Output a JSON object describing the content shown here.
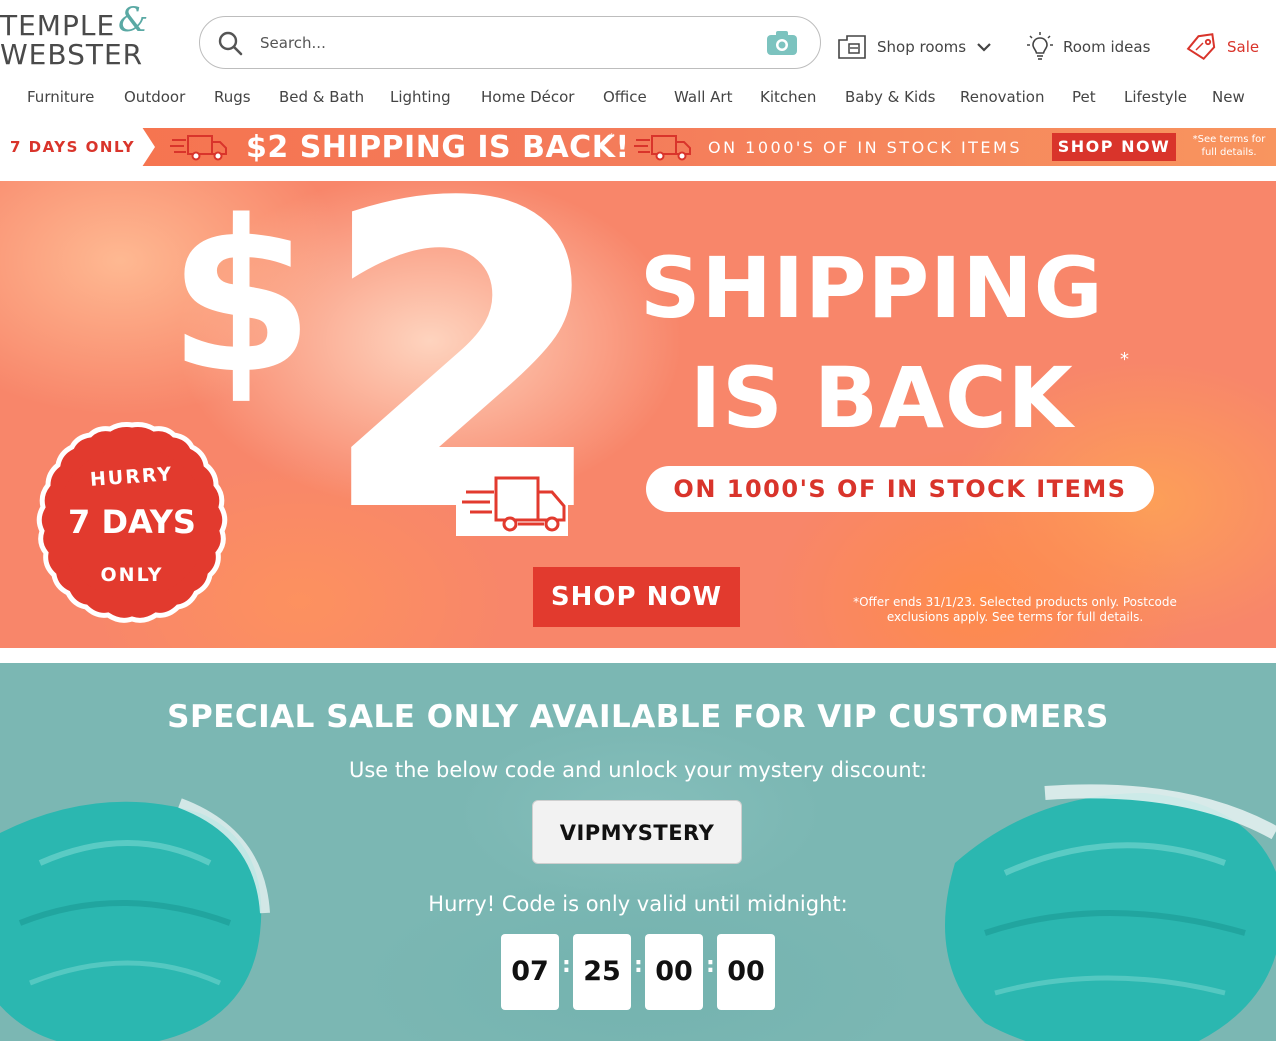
{
  "brand": {
    "line1": "TEMPLE",
    "line2": "WEBSTER",
    "ampersand": "&",
    "accent": "#5aa9a4"
  },
  "search": {
    "placeholder": "Search...",
    "value": ""
  },
  "header_links": {
    "shop_rooms": "Shop rooms",
    "room_ideas": "Room ideas",
    "sale": "Sale"
  },
  "nav": [
    "Furniture",
    "Outdoor",
    "Rugs",
    "Bed & Bath",
    "Lighting",
    "Home Décor",
    "Office",
    "Wall Art",
    "Kitchen",
    "Baby & Kids",
    "Renovation",
    "Pet",
    "Lifestyle",
    "New"
  ],
  "strip": {
    "days": "7 DAYS ONLY",
    "headline": "$2 SHIPPING IS BACK!",
    "star": "*",
    "items": "ON 1000'S OF IN STOCK ITEMS",
    "cta": "SHOP NOW",
    "terms": "*See terms for full details."
  },
  "hero": {
    "dollar": "$",
    "amount": "2",
    "title_line1": "SHIPPING",
    "title_line2": "IS BACK",
    "star": "*",
    "pill": "ON 1000'S OF IN STOCK ITEMS",
    "cta": "SHOP NOW",
    "fine_print": "*Offer ends 31/1/23. Selected products only. Postcode exclusions apply. See terms for full details.",
    "badge": {
      "top": "HURRY",
      "middle": "7 DAYS",
      "bottom": "ONLY"
    }
  },
  "vip": {
    "heading": "SPECIAL SALE ONLY AVAILABLE FOR VIP CUSTOMERS",
    "subtext": "Use the below code and unlock your mystery discount:",
    "code": "VIPMYSTERY",
    "hurry": "Hurry! Code is only valid until midnight:",
    "countdown": [
      "07",
      "25",
      "00",
      "00"
    ]
  },
  "colors": {
    "red": "#d9342b",
    "teal": "#7bb7b3",
    "coral": "#f8866a"
  }
}
